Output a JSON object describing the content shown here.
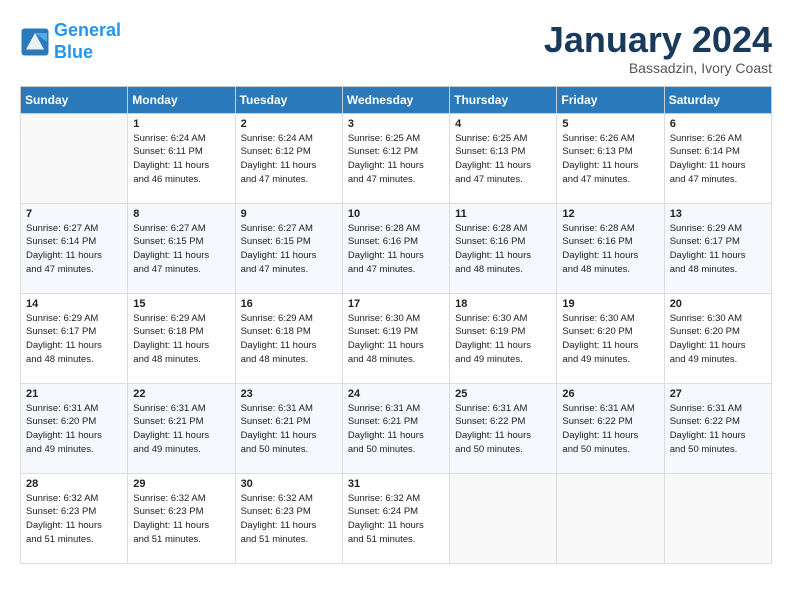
{
  "header": {
    "logo_line1": "General",
    "logo_line2": "Blue",
    "month": "January 2024",
    "location": "Bassadzin, Ivory Coast"
  },
  "days_of_week": [
    "Sunday",
    "Monday",
    "Tuesday",
    "Wednesday",
    "Thursday",
    "Friday",
    "Saturday"
  ],
  "weeks": [
    [
      {
        "day": "",
        "info": ""
      },
      {
        "day": "1",
        "info": "Sunrise: 6:24 AM\nSunset: 6:11 PM\nDaylight: 11 hours\nand 46 minutes."
      },
      {
        "day": "2",
        "info": "Sunrise: 6:24 AM\nSunset: 6:12 PM\nDaylight: 11 hours\nand 47 minutes."
      },
      {
        "day": "3",
        "info": "Sunrise: 6:25 AM\nSunset: 6:12 PM\nDaylight: 11 hours\nand 47 minutes."
      },
      {
        "day": "4",
        "info": "Sunrise: 6:25 AM\nSunset: 6:13 PM\nDaylight: 11 hours\nand 47 minutes."
      },
      {
        "day": "5",
        "info": "Sunrise: 6:26 AM\nSunset: 6:13 PM\nDaylight: 11 hours\nand 47 minutes."
      },
      {
        "day": "6",
        "info": "Sunrise: 6:26 AM\nSunset: 6:14 PM\nDaylight: 11 hours\nand 47 minutes."
      }
    ],
    [
      {
        "day": "7",
        "info": "Sunrise: 6:27 AM\nSunset: 6:14 PM\nDaylight: 11 hours\nand 47 minutes."
      },
      {
        "day": "8",
        "info": "Sunrise: 6:27 AM\nSunset: 6:15 PM\nDaylight: 11 hours\nand 47 minutes."
      },
      {
        "day": "9",
        "info": "Sunrise: 6:27 AM\nSunset: 6:15 PM\nDaylight: 11 hours\nand 47 minutes."
      },
      {
        "day": "10",
        "info": "Sunrise: 6:28 AM\nSunset: 6:16 PM\nDaylight: 11 hours\nand 47 minutes."
      },
      {
        "day": "11",
        "info": "Sunrise: 6:28 AM\nSunset: 6:16 PM\nDaylight: 11 hours\nand 48 minutes."
      },
      {
        "day": "12",
        "info": "Sunrise: 6:28 AM\nSunset: 6:16 PM\nDaylight: 11 hours\nand 48 minutes."
      },
      {
        "day": "13",
        "info": "Sunrise: 6:29 AM\nSunset: 6:17 PM\nDaylight: 11 hours\nand 48 minutes."
      }
    ],
    [
      {
        "day": "14",
        "info": "Sunrise: 6:29 AM\nSunset: 6:17 PM\nDaylight: 11 hours\nand 48 minutes."
      },
      {
        "day": "15",
        "info": "Sunrise: 6:29 AM\nSunset: 6:18 PM\nDaylight: 11 hours\nand 48 minutes."
      },
      {
        "day": "16",
        "info": "Sunrise: 6:29 AM\nSunset: 6:18 PM\nDaylight: 11 hours\nand 48 minutes."
      },
      {
        "day": "17",
        "info": "Sunrise: 6:30 AM\nSunset: 6:19 PM\nDaylight: 11 hours\nand 48 minutes."
      },
      {
        "day": "18",
        "info": "Sunrise: 6:30 AM\nSunset: 6:19 PM\nDaylight: 11 hours\nand 49 minutes."
      },
      {
        "day": "19",
        "info": "Sunrise: 6:30 AM\nSunset: 6:20 PM\nDaylight: 11 hours\nand 49 minutes."
      },
      {
        "day": "20",
        "info": "Sunrise: 6:30 AM\nSunset: 6:20 PM\nDaylight: 11 hours\nand 49 minutes."
      }
    ],
    [
      {
        "day": "21",
        "info": "Sunrise: 6:31 AM\nSunset: 6:20 PM\nDaylight: 11 hours\nand 49 minutes."
      },
      {
        "day": "22",
        "info": "Sunrise: 6:31 AM\nSunset: 6:21 PM\nDaylight: 11 hours\nand 49 minutes."
      },
      {
        "day": "23",
        "info": "Sunrise: 6:31 AM\nSunset: 6:21 PM\nDaylight: 11 hours\nand 50 minutes."
      },
      {
        "day": "24",
        "info": "Sunrise: 6:31 AM\nSunset: 6:21 PM\nDaylight: 11 hours\nand 50 minutes."
      },
      {
        "day": "25",
        "info": "Sunrise: 6:31 AM\nSunset: 6:22 PM\nDaylight: 11 hours\nand 50 minutes."
      },
      {
        "day": "26",
        "info": "Sunrise: 6:31 AM\nSunset: 6:22 PM\nDaylight: 11 hours\nand 50 minutes."
      },
      {
        "day": "27",
        "info": "Sunrise: 6:31 AM\nSunset: 6:22 PM\nDaylight: 11 hours\nand 50 minutes."
      }
    ],
    [
      {
        "day": "28",
        "info": "Sunrise: 6:32 AM\nSunset: 6:23 PM\nDaylight: 11 hours\nand 51 minutes."
      },
      {
        "day": "29",
        "info": "Sunrise: 6:32 AM\nSunset: 6:23 PM\nDaylight: 11 hours\nand 51 minutes."
      },
      {
        "day": "30",
        "info": "Sunrise: 6:32 AM\nSunset: 6:23 PM\nDaylight: 11 hours\nand 51 minutes."
      },
      {
        "day": "31",
        "info": "Sunrise: 6:32 AM\nSunset: 6:24 PM\nDaylight: 11 hours\nand 51 minutes."
      },
      {
        "day": "",
        "info": ""
      },
      {
        "day": "",
        "info": ""
      },
      {
        "day": "",
        "info": ""
      }
    ]
  ]
}
